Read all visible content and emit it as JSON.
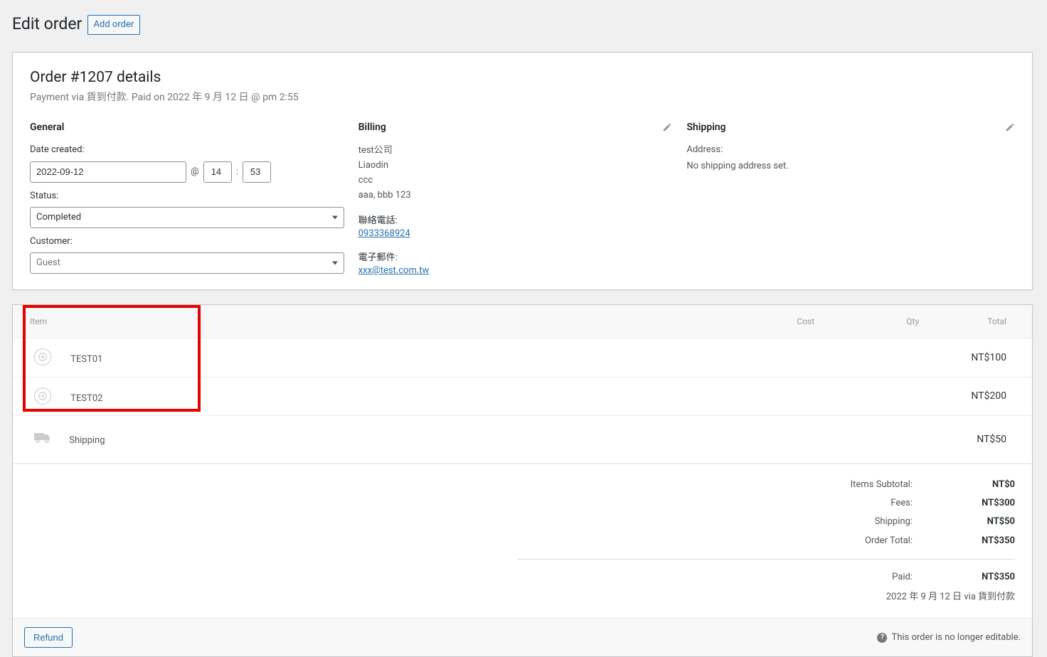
{
  "page": {
    "title": "Edit order",
    "add_order": "Add order"
  },
  "order": {
    "heading": "Order #1207 details",
    "subtext": "Payment via 貨到付款. Paid on 2022 年 9 月 12 日 @ pm 2:55"
  },
  "general": {
    "heading": "General",
    "date_label": "Date created:",
    "date_value": "2022-09-12",
    "at": "@",
    "hour": "14",
    "colon": ":",
    "minute": "53",
    "status_label": "Status:",
    "status_value": "Completed",
    "customer_label": "Customer:",
    "customer_value": "Guest"
  },
  "billing": {
    "heading": "Billing",
    "line1": "test公司",
    "line2": "Liaodin",
    "line3": "ccc",
    "line4": "aaa, bbb 123",
    "phone_label": "聯絡電話:",
    "phone_value": "0933368924",
    "email_label": "電子郵件:",
    "email_value": "xxx@test.com.tw"
  },
  "shipping": {
    "heading": "Shipping",
    "address_label": "Address:",
    "no_address": "No shipping address set."
  },
  "columns": {
    "item": "Item",
    "cost": "Cost",
    "qty": "Qty",
    "total": "Total"
  },
  "items": [
    {
      "name": "TEST01",
      "total": "NT$100"
    },
    {
      "name": "TEST02",
      "total": "NT$200"
    }
  ],
  "shipping_line": {
    "name": "Shipping",
    "total": "NT$50"
  },
  "totals": {
    "items_subtotal_label": "Items Subtotal:",
    "items_subtotal_value": "NT$0",
    "fees_label": "Fees:",
    "fees_value": "NT$300",
    "shipping_label": "Shipping:",
    "shipping_value": "NT$50",
    "order_total_label": "Order Total:",
    "order_total_value": "NT$350",
    "paid_label": "Paid:",
    "paid_value": "NT$350",
    "paid_date": "2022 年 9 月 12 日 via 貨到付款"
  },
  "footer": {
    "refund": "Refund",
    "notice": "This order is no longer editable."
  }
}
